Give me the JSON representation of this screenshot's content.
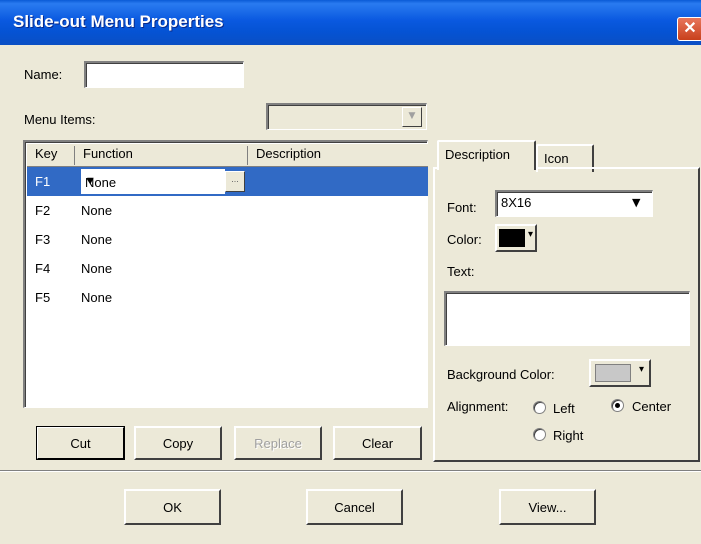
{
  "window": {
    "title": "Slide-out Menu Properties",
    "close_glyph": "✕"
  },
  "name_field": {
    "label": "Name:",
    "value": ""
  },
  "menu_items": {
    "label": "Menu Items:",
    "value": "",
    "arrow": "▼"
  },
  "grid": {
    "headers": [
      "Key",
      "Function",
      "Description"
    ],
    "rows": [
      {
        "key": "F1",
        "function": "None",
        "description": "",
        "selected": true
      },
      {
        "key": "F2",
        "function": "None",
        "description": ""
      },
      {
        "key": "F3",
        "function": "None",
        "description": ""
      },
      {
        "key": "F4",
        "function": "None",
        "description": ""
      },
      {
        "key": "F5",
        "function": "None",
        "description": ""
      }
    ],
    "dropdown_arrow": "▼",
    "ellipsis": "..."
  },
  "edit_buttons": {
    "cut": "Cut",
    "copy": "Copy",
    "replace": "Replace",
    "clear": "Clear"
  },
  "tabs": {
    "description": "Description",
    "icon": "Icon"
  },
  "description_tab": {
    "font_label": "Font:",
    "font_value": "8X16",
    "font_arrow": "▼",
    "color_label": "Color:",
    "color_value": "#000000",
    "color_arrow": "▾",
    "text_label": "Text:",
    "text_value": "",
    "bg_color_label": "Background Color:",
    "bg_color_value": "#c8c8c8",
    "bg_color_arrow": "▾",
    "alignment_label": "Alignment:",
    "alignment_options": [
      "Left",
      "Center",
      "Right"
    ],
    "alignment_selected": "Center"
  },
  "footer": {
    "ok": "OK",
    "cancel": "Cancel",
    "view": "View..."
  },
  "colors": {
    "title_blue": "#0a59e0",
    "selection": "#316ac5",
    "face": "#ece9d8"
  }
}
